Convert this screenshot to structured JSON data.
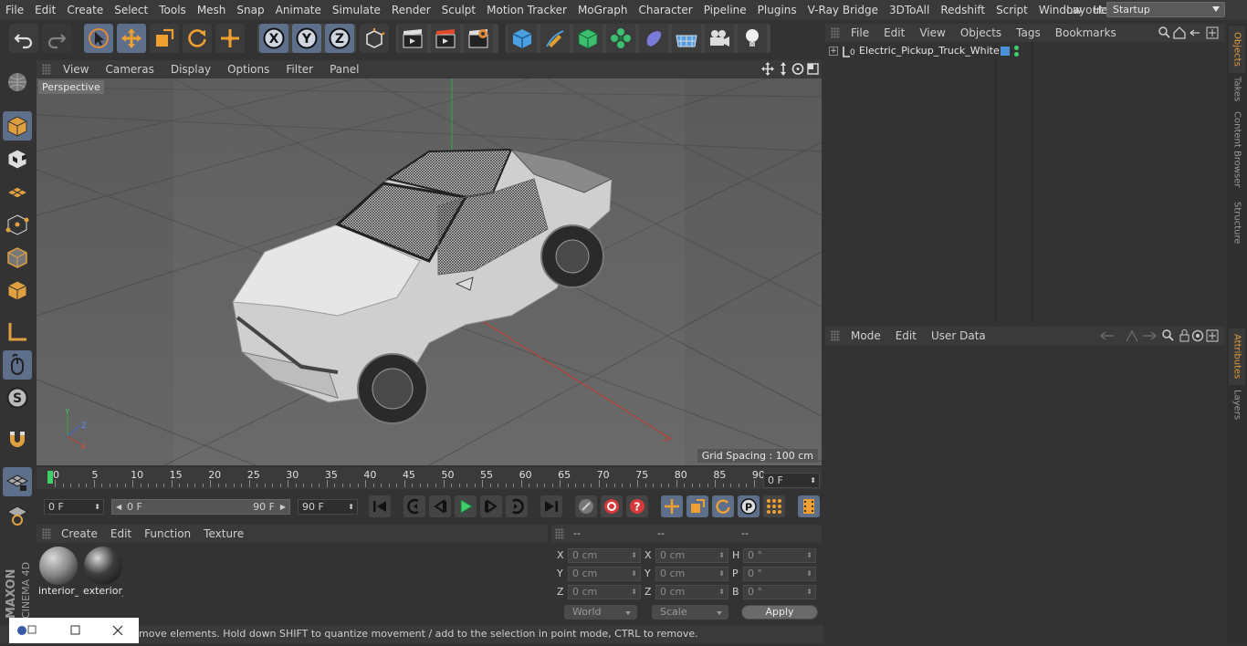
{
  "menubar": {
    "items": [
      "File",
      "Edit",
      "Create",
      "Select",
      "Tools",
      "Mesh",
      "Snap",
      "Animate",
      "Simulate",
      "Render",
      "Sculpt",
      "Motion Tracker",
      "MoGraph",
      "Character",
      "Pipeline",
      "Plugins",
      "V-Ray Bridge",
      "3DToAll",
      "Redshift",
      "Script",
      "Window",
      "Help"
    ],
    "layout_label": "Layout:",
    "layout_value": "Startup"
  },
  "viewport": {
    "menu": [
      "View",
      "Cameras",
      "Display",
      "Options",
      "Filter",
      "Panel"
    ],
    "label": "Perspective",
    "grid_spacing": "Grid Spacing : 100 cm"
  },
  "timeline": {
    "ticks": [
      "0",
      "5",
      "10",
      "15",
      "20",
      "25",
      "30",
      "35",
      "40",
      "45",
      "50",
      "55",
      "60",
      "65",
      "70",
      "75",
      "80",
      "85",
      "90"
    ],
    "current_frame": "0 F"
  },
  "playbar": {
    "start": "0 F",
    "range_start": "0 F",
    "range_end": "90 F",
    "end": "90 F"
  },
  "materials": {
    "menu": [
      "Create",
      "Edit",
      "Function",
      "Texture"
    ],
    "items": [
      {
        "name": "interior_",
        "color": "#8a8a8a"
      },
      {
        "name": "exterior_",
        "color": "#3c3c3c"
      }
    ]
  },
  "coords": {
    "headers": [
      "--",
      "--",
      "--"
    ],
    "rows": [
      {
        "l1": "X",
        "v1": "0 cm",
        "l2": "X",
        "v2": "0 cm",
        "l3": "H",
        "v3": "0 °"
      },
      {
        "l1": "Y",
        "v1": "0 cm",
        "l2": "Y",
        "v2": "0 cm",
        "l3": "P",
        "v3": "0 °"
      },
      {
        "l1": "Z",
        "v1": "0 cm",
        "l2": "Z",
        "v2": "0 cm",
        "l3": "B",
        "v3": "0 °"
      }
    ],
    "world": "World",
    "scale": "Scale",
    "apply": "Apply"
  },
  "status": "move elements. Hold down SHIFT to quantize movement / add to the selection in point mode, CTRL to remove.",
  "objects": {
    "menu": [
      "File",
      "Edit",
      "View",
      "Objects",
      "Tags",
      "Bookmarks"
    ],
    "tree": [
      {
        "name": "Electric_Pickup_Truck_White",
        "icon": "null-object-icon"
      }
    ]
  },
  "attributes": {
    "menu": [
      "Mode",
      "Edit",
      "User Data"
    ]
  },
  "right_tabs": [
    "Objects",
    "Takes",
    "Content Browser",
    "Structure",
    "Attributes",
    "Layers"
  ],
  "logo_text": [
    "MAXON",
    "CINEMA 4D"
  ],
  "colors": {
    "accent": "#5d6f8a",
    "orange": "#e09a3a",
    "timeline_marker": "#3ecf6a"
  }
}
